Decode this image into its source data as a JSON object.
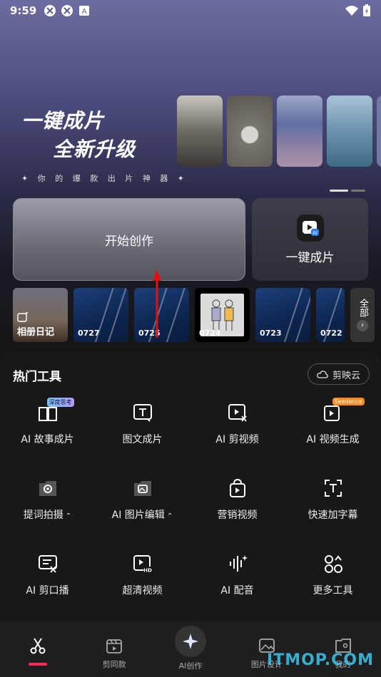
{
  "status": {
    "time": "9:59"
  },
  "banner": {
    "line1": "一键成片",
    "line2": "全新升级",
    "tagline": "✦ 你 的 爆 款 出 片 神 器 ✦"
  },
  "cards": {
    "start": "开始创作",
    "one_click": "一键成片"
  },
  "reel": {
    "album": "相册日记",
    "items": [
      "0727",
      "0725",
      "0724",
      "0723",
      "0722"
    ],
    "all": "全部"
  },
  "panel": {
    "title": "热门工具",
    "cloud": "剪映云",
    "tools": [
      {
        "label": "AI 故事成片",
        "icon": "book-icon",
        "badge": "深度思考"
      },
      {
        "label": "图文成片",
        "icon": "text-frame-icon"
      },
      {
        "label": "AI 剪视频",
        "icon": "video-scissor-icon"
      },
      {
        "label": "AI 视频生成",
        "icon": "video-sparkle-icon",
        "badge": "Seedance"
      },
      {
        "label": "提词拍摄",
        "icon": "camera-folder-icon"
      },
      {
        "label": "AI 图片编辑",
        "icon": "image-folder-icon"
      },
      {
        "label": "营销视频",
        "icon": "shopping-bag-icon"
      },
      {
        "label": "快速加字幕",
        "icon": "caption-icon"
      },
      {
        "label": "AI 剪口播",
        "icon": "script-scissor-icon"
      },
      {
        "label": "超清视频",
        "icon": "hd-video-icon"
      },
      {
        "label": "AI 配音",
        "icon": "waveform-icon"
      },
      {
        "label": "更多工具",
        "icon": "more-grid-icon"
      }
    ]
  },
  "nav": {
    "edit": "",
    "templates": "剪同款",
    "ai": "AI创作",
    "image": "图片设计",
    "me": "我的"
  },
  "watermark": "ITMOP.COM",
  "colors": {
    "accent": "#fe2c55",
    "panel": "#181818"
  }
}
